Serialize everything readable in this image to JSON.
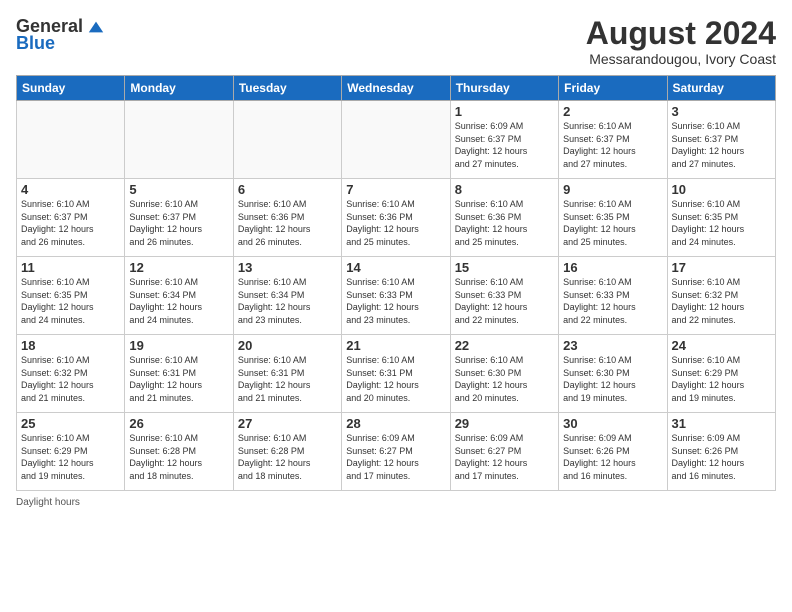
{
  "logo": {
    "general": "General",
    "blue": "Blue"
  },
  "title": "August 2024",
  "subtitle": "Messarandougou, Ivory Coast",
  "days_of_week": [
    "Sunday",
    "Monday",
    "Tuesday",
    "Wednesday",
    "Thursday",
    "Friday",
    "Saturday"
  ],
  "footer": "Daylight hours",
  "weeks": [
    [
      {
        "day": "",
        "info": ""
      },
      {
        "day": "",
        "info": ""
      },
      {
        "day": "",
        "info": ""
      },
      {
        "day": "",
        "info": ""
      },
      {
        "day": "1",
        "info": "Sunrise: 6:09 AM\nSunset: 6:37 PM\nDaylight: 12 hours\nand 27 minutes."
      },
      {
        "day": "2",
        "info": "Sunrise: 6:10 AM\nSunset: 6:37 PM\nDaylight: 12 hours\nand 27 minutes."
      },
      {
        "day": "3",
        "info": "Sunrise: 6:10 AM\nSunset: 6:37 PM\nDaylight: 12 hours\nand 27 minutes."
      }
    ],
    [
      {
        "day": "4",
        "info": "Sunrise: 6:10 AM\nSunset: 6:37 PM\nDaylight: 12 hours\nand 26 minutes."
      },
      {
        "day": "5",
        "info": "Sunrise: 6:10 AM\nSunset: 6:37 PM\nDaylight: 12 hours\nand 26 minutes."
      },
      {
        "day": "6",
        "info": "Sunrise: 6:10 AM\nSunset: 6:36 PM\nDaylight: 12 hours\nand 26 minutes."
      },
      {
        "day": "7",
        "info": "Sunrise: 6:10 AM\nSunset: 6:36 PM\nDaylight: 12 hours\nand 25 minutes."
      },
      {
        "day": "8",
        "info": "Sunrise: 6:10 AM\nSunset: 6:36 PM\nDaylight: 12 hours\nand 25 minutes."
      },
      {
        "day": "9",
        "info": "Sunrise: 6:10 AM\nSunset: 6:35 PM\nDaylight: 12 hours\nand 25 minutes."
      },
      {
        "day": "10",
        "info": "Sunrise: 6:10 AM\nSunset: 6:35 PM\nDaylight: 12 hours\nand 24 minutes."
      }
    ],
    [
      {
        "day": "11",
        "info": "Sunrise: 6:10 AM\nSunset: 6:35 PM\nDaylight: 12 hours\nand 24 minutes."
      },
      {
        "day": "12",
        "info": "Sunrise: 6:10 AM\nSunset: 6:34 PM\nDaylight: 12 hours\nand 24 minutes."
      },
      {
        "day": "13",
        "info": "Sunrise: 6:10 AM\nSunset: 6:34 PM\nDaylight: 12 hours\nand 23 minutes."
      },
      {
        "day": "14",
        "info": "Sunrise: 6:10 AM\nSunset: 6:33 PM\nDaylight: 12 hours\nand 23 minutes."
      },
      {
        "day": "15",
        "info": "Sunrise: 6:10 AM\nSunset: 6:33 PM\nDaylight: 12 hours\nand 22 minutes."
      },
      {
        "day": "16",
        "info": "Sunrise: 6:10 AM\nSunset: 6:33 PM\nDaylight: 12 hours\nand 22 minutes."
      },
      {
        "day": "17",
        "info": "Sunrise: 6:10 AM\nSunset: 6:32 PM\nDaylight: 12 hours\nand 22 minutes."
      }
    ],
    [
      {
        "day": "18",
        "info": "Sunrise: 6:10 AM\nSunset: 6:32 PM\nDaylight: 12 hours\nand 21 minutes."
      },
      {
        "day": "19",
        "info": "Sunrise: 6:10 AM\nSunset: 6:31 PM\nDaylight: 12 hours\nand 21 minutes."
      },
      {
        "day": "20",
        "info": "Sunrise: 6:10 AM\nSunset: 6:31 PM\nDaylight: 12 hours\nand 21 minutes."
      },
      {
        "day": "21",
        "info": "Sunrise: 6:10 AM\nSunset: 6:31 PM\nDaylight: 12 hours\nand 20 minutes."
      },
      {
        "day": "22",
        "info": "Sunrise: 6:10 AM\nSunset: 6:30 PM\nDaylight: 12 hours\nand 20 minutes."
      },
      {
        "day": "23",
        "info": "Sunrise: 6:10 AM\nSunset: 6:30 PM\nDaylight: 12 hours\nand 19 minutes."
      },
      {
        "day": "24",
        "info": "Sunrise: 6:10 AM\nSunset: 6:29 PM\nDaylight: 12 hours\nand 19 minutes."
      }
    ],
    [
      {
        "day": "25",
        "info": "Sunrise: 6:10 AM\nSunset: 6:29 PM\nDaylight: 12 hours\nand 19 minutes."
      },
      {
        "day": "26",
        "info": "Sunrise: 6:10 AM\nSunset: 6:28 PM\nDaylight: 12 hours\nand 18 minutes."
      },
      {
        "day": "27",
        "info": "Sunrise: 6:10 AM\nSunset: 6:28 PM\nDaylight: 12 hours\nand 18 minutes."
      },
      {
        "day": "28",
        "info": "Sunrise: 6:09 AM\nSunset: 6:27 PM\nDaylight: 12 hours\nand 17 minutes."
      },
      {
        "day": "29",
        "info": "Sunrise: 6:09 AM\nSunset: 6:27 PM\nDaylight: 12 hours\nand 17 minutes."
      },
      {
        "day": "30",
        "info": "Sunrise: 6:09 AM\nSunset: 6:26 PM\nDaylight: 12 hours\nand 16 minutes."
      },
      {
        "day": "31",
        "info": "Sunrise: 6:09 AM\nSunset: 6:26 PM\nDaylight: 12 hours\nand 16 minutes."
      }
    ]
  ]
}
